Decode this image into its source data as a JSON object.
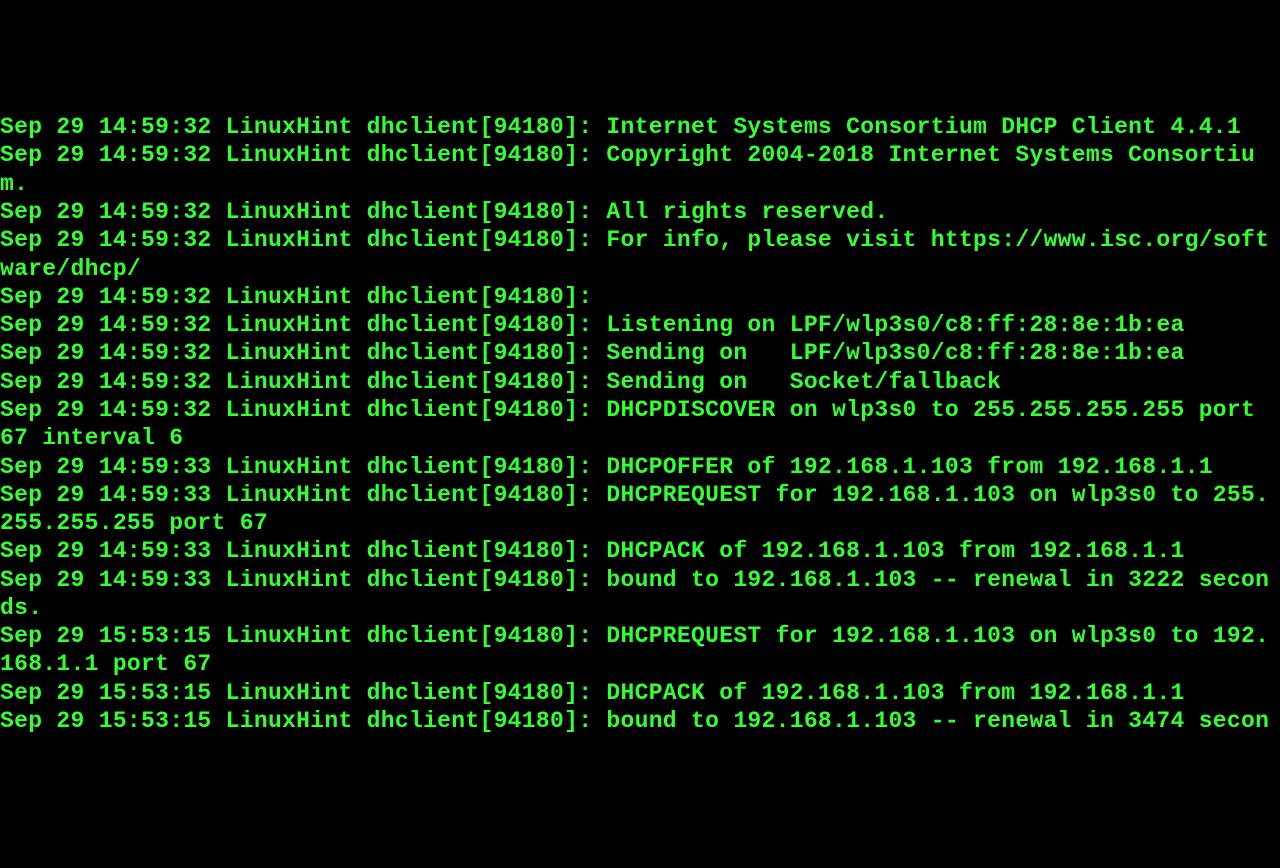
{
  "terminal": {
    "lines": [
      "Sep 29 14:59:32 LinuxHint dhclient[94180]: Internet Systems Consortium DHCP Client 4.4.1",
      "Sep 29 14:59:32 LinuxHint dhclient[94180]: Copyright 2004-2018 Internet Systems Consortium.",
      "Sep 29 14:59:32 LinuxHint dhclient[94180]: All rights reserved.",
      "Sep 29 14:59:32 LinuxHint dhclient[94180]: For info, please visit https://www.isc.org/software/dhcp/",
      "Sep 29 14:59:32 LinuxHint dhclient[94180]:",
      "Sep 29 14:59:32 LinuxHint dhclient[94180]: Listening on LPF/wlp3s0/c8:ff:28:8e:1b:ea",
      "Sep 29 14:59:32 LinuxHint dhclient[94180]: Sending on   LPF/wlp3s0/c8:ff:28:8e:1b:ea",
      "Sep 29 14:59:32 LinuxHint dhclient[94180]: Sending on   Socket/fallback",
      "Sep 29 14:59:32 LinuxHint dhclient[94180]: DHCPDISCOVER on wlp3s0 to 255.255.255.255 port 67 interval 6",
      "Sep 29 14:59:33 LinuxHint dhclient[94180]: DHCPOFFER of 192.168.1.103 from 192.168.1.1",
      "Sep 29 14:59:33 LinuxHint dhclient[94180]: DHCPREQUEST for 192.168.1.103 on wlp3s0 to 255.255.255.255 port 67",
      "Sep 29 14:59:33 LinuxHint dhclient[94180]: DHCPACK of 192.168.1.103 from 192.168.1.1",
      "Sep 29 14:59:33 LinuxHint dhclient[94180]: bound to 192.168.1.103 -- renewal in 3222 seconds.",
      "Sep 29 15:53:15 LinuxHint dhclient[94180]: DHCPREQUEST for 192.168.1.103 on wlp3s0 to 192.168.1.1 port 67",
      "Sep 29 15:53:15 LinuxHint dhclient[94180]: DHCPACK of 192.168.1.103 from 192.168.1.1",
      "Sep 29 15:53:15 LinuxHint dhclient[94180]: bound to 192.168.1.103 -- renewal in 3474 secon"
    ]
  }
}
